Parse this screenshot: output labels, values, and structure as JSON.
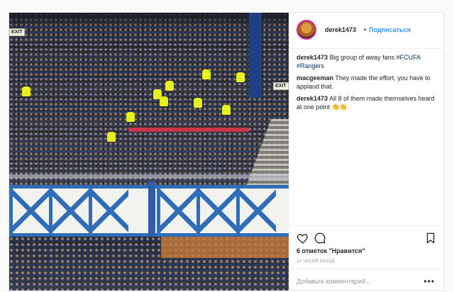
{
  "post": {
    "username": "derek1473",
    "separator": "•",
    "follow_label": "Подписаться",
    "photo_alt": "Stadium crowd with away fans"
  },
  "comments": [
    {
      "user": "derek1473",
      "text": "Big group of away fans ",
      "tags": "#FCUFA #Rangers"
    },
    {
      "user": "macgeeman",
      "text": "They made the effort, you have to applaud that.",
      "tags": ""
    },
    {
      "user": "derek1473",
      "text": "All 8 of them made themselves heard at one point 👏👏",
      "tags": ""
    }
  ],
  "actions": {
    "likes": "6 отметок \"Нравится\"",
    "timestamp": "14 ЧАСОВ НАЗАД",
    "comment_placeholder": "Добавьте комментарий...",
    "more": "•••"
  },
  "photo_signs": {
    "exit_left": "EXIT",
    "exit_right": "EXIT"
  },
  "colors": {
    "follow_blue": "#3897f0",
    "hashtag": "#003569",
    "steward_yellow": "#e7f21c",
    "truss_blue": "#2f6db8"
  },
  "icons": [
    "heart-icon",
    "comment-icon",
    "bookmark-icon",
    "more-options-icon"
  ]
}
